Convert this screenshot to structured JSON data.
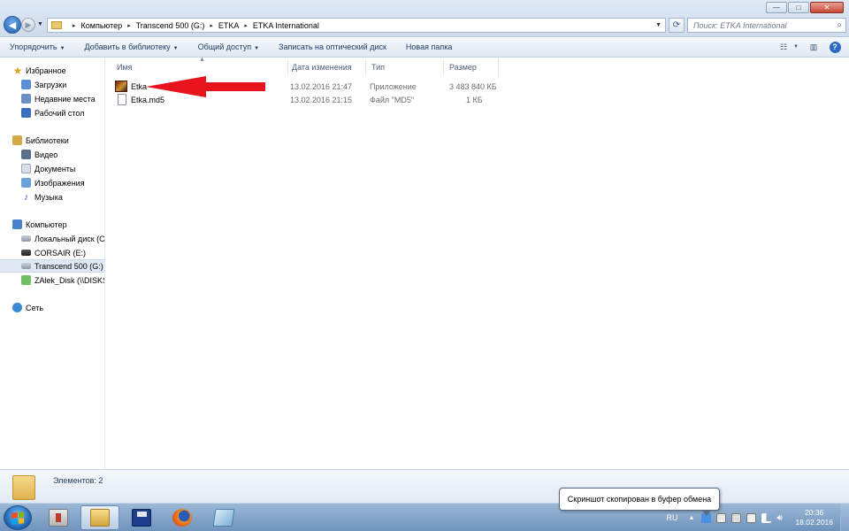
{
  "window": {
    "min_symbol": "—",
    "max_symbol": "□",
    "close_symbol": "✕"
  },
  "address": {
    "segments": [
      "Компьютер",
      "Transcend 500 (G:)",
      "ETKA",
      "ETKA International"
    ],
    "separator": "▸"
  },
  "search": {
    "placeholder": "Поиск: ETKA International"
  },
  "toolbar": {
    "organize": "Упорядочить",
    "add_to_library": "Добавить в библиотеку",
    "share": "Общий доступ",
    "burn": "Записать на оптический диск",
    "new_folder": "Новая папка",
    "dropdown_arrow": "▼"
  },
  "sidebar": {
    "favorites": {
      "label": "Избранное",
      "items": [
        "Загрузки",
        "Недавние места",
        "Рабочий стол"
      ]
    },
    "libraries": {
      "label": "Библиотеки",
      "items": [
        "Видео",
        "Документы",
        "Изображения",
        "Музыка"
      ]
    },
    "computer": {
      "label": "Компьютер",
      "items": [
        "Локальный диск (C:)",
        "CORSAIR (E:)",
        "Transcend 500 (G:)",
        "ZAlek_Disk (\\\\DISKST"
      ],
      "selected_index": 2
    },
    "network": {
      "label": "Сеть"
    }
  },
  "columns": {
    "name": "Имя",
    "date": "Дата изменения",
    "type": "Тип",
    "size": "Размер"
  },
  "files": [
    {
      "name": "Etka",
      "date": "13.02.2016 21:47",
      "type": "Приложение",
      "size": "3 483 840 КБ",
      "icon": "etka-app-icon"
    },
    {
      "name": "Etka.md5",
      "date": "13.02.2016 21:15",
      "type": "Файл \"MD5\"",
      "size": "1 КБ",
      "icon": "file-icon"
    }
  ],
  "details": {
    "count_text": "Элементов: 2"
  },
  "taskbar": {
    "apps": [
      "download-manager-icon",
      "explorer-icon",
      "floppy-save-icon",
      "firefox-icon",
      "notes-icon"
    ],
    "active_app": "explorer-icon",
    "lang": "RU",
    "time": "20:36",
    "date": "18.02.2016"
  },
  "balloon": {
    "text": "Скриншот скопирован в буфер обмена"
  },
  "colors": {
    "annotation_arrow": "#e8141c",
    "selected_nav": "#dfe8f4",
    "taskbar": "#7f9fc6"
  }
}
